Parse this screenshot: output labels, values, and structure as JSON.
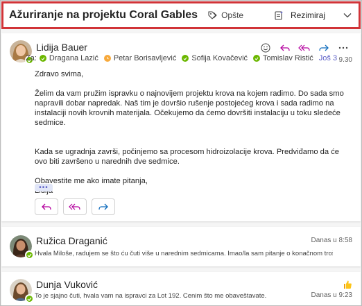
{
  "header": {
    "subject": "Ažuriranje na projektu Coral Gables",
    "tag_label": "Opšte",
    "summarize_label": "Rezimiraj"
  },
  "message": {
    "sender": "Lidija Bauer",
    "to_label": "Za:",
    "recipients": [
      {
        "name": "Dragana Lazić",
        "status": "available"
      },
      {
        "name": "Petar Borisavljević",
        "status": "away"
      },
      {
        "name": "Sofija Kovačević",
        "status": "available"
      },
      {
        "name": "Tomislav Ristić",
        "status": "available"
      }
    ],
    "more_label": "Još 3",
    "time": "9.30",
    "body": {
      "greeting": "Zdravo svima,",
      "p1": "Želim da vam pružim ispravku o najnovijem projektu krova na kojem radimo. Do sada smo napravili dobar napredak. Naš tim je dovršio rušenje postojećeg krova i sada radimo na instalaciji novih krovnih materijala. Očekujemo da ćemo dovršiti instalaciju u toku sledeće sedmice.",
      "p2": "Kada se ugradnja završi, počinjemo sa procesom hidroizolacije krova. Predviđamo da će ovo biti završeno u narednih dve sedmice.",
      "p3": "Obavestite me ako imate pitanja,",
      "signature": "Lidija"
    },
    "ellipsis": "•••"
  },
  "threads": [
    {
      "sender": "Ružica Draganić",
      "time": "Danas u 8:58",
      "preview": "Hvala Miloše, radujem se što ću čuti više u narednim sedmicama. Imao/la sam pitanje o konačnom trošku..."
    },
    {
      "sender": "Dunja Vuković",
      "time": "Danas u 9:23",
      "preview": "To je sjajno čuti, hvala vam na ispravci za Lot 192. Cenim što me obaveštavate."
    }
  ],
  "colors": {
    "accent": "#5b5fc7",
    "highlight_border": "#d13438",
    "presence_available": "#6bb700",
    "presence_away": "#f7a93b"
  }
}
